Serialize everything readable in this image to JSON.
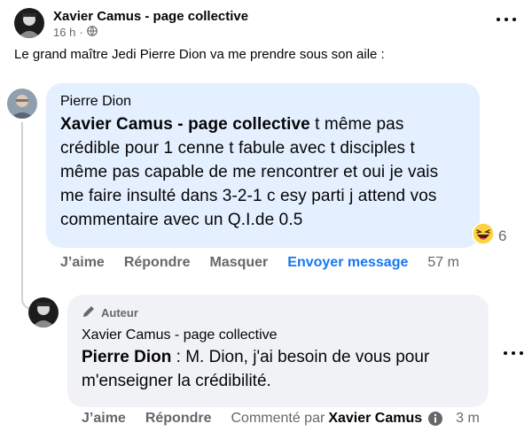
{
  "post": {
    "author": "Xavier Camus - page collective",
    "time": "16 h",
    "separator": "·",
    "text": "Le grand maître Jedi Pierre Dion va me prendre sous son aile :"
  },
  "comment1": {
    "author": "Pierre Dion",
    "mention": "Xavier Camus - page collective",
    "text": " t même pas crédible pour 1 cenne t fabule avec t disciples t même pas capable de me rencontrer et oui je vais me faire insulté dans 3-2-1 c esy parti j attend vos commentaire avec un Q.I.de 0.5",
    "reaction_count": "6",
    "reaction_emoji": "haha-emoji",
    "actions": {
      "like": "J’aime",
      "reply": "Répondre",
      "hide": "Masquer",
      "send": "Envoyer message",
      "time": "57 m"
    }
  },
  "comment2": {
    "badge": "Auteur",
    "author": "Xavier Camus - page collective",
    "mention": "Pierre Dion",
    "text": " : M. Dion, j'ai besoin de vous pour m'enseigner la crédibilité.",
    "actions": {
      "like": "J’aime",
      "reply": "Répondre",
      "commented_by": "Commenté par",
      "commented_by_name": "Xavier Camus",
      "time": "3 m"
    }
  },
  "colors": {
    "link": "#1877f2",
    "bubble_highlight": "#e4efff",
    "bubble": "#f0f2f5",
    "secondary_text": "#65676b"
  }
}
